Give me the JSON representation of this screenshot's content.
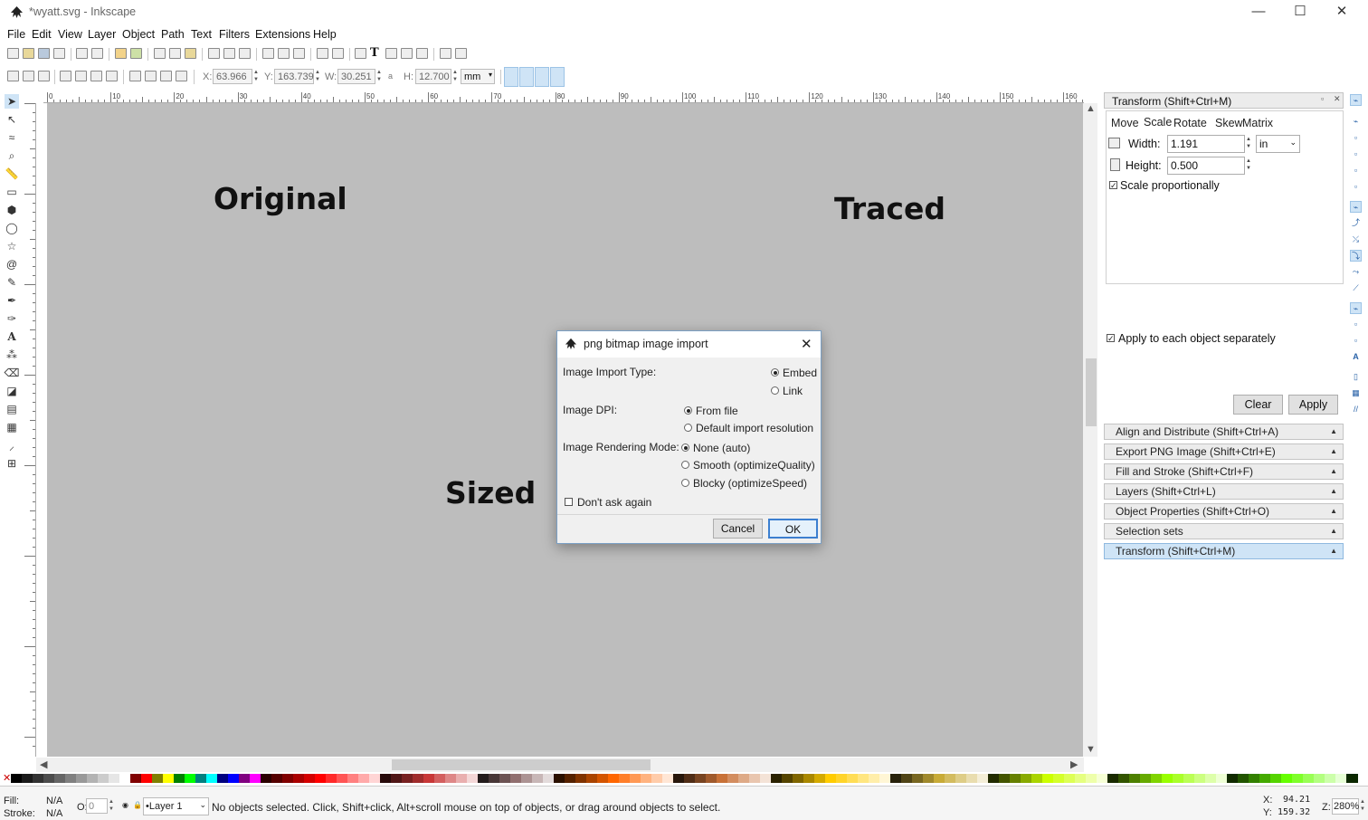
{
  "window": {
    "title": "*wyatt.svg - Inkscape",
    "minimize": "—",
    "maximize": "☐",
    "close": "✕"
  },
  "menubar": [
    "File",
    "Edit",
    "View",
    "Layer",
    "Object",
    "Path",
    "Text",
    "Filters",
    "Extensions",
    "Help"
  ],
  "controls": {
    "x_label": "X:",
    "x_value": "63.966",
    "y_label": "Y:",
    "y_value": "163.739",
    "w_label": "W:",
    "w_value": "30.251",
    "h_label": "H:",
    "h_value": "12.700",
    "unit": "mm"
  },
  "ruler_top": [
    "0",
    "10",
    "20",
    "30",
    "40",
    "50",
    "60",
    "70",
    "80",
    "90",
    "100",
    "110",
    "120",
    "130",
    "140",
    "150",
    "160"
  ],
  "canvas": {
    "texts": [
      "Original",
      "Traced",
      "Sized"
    ],
    "background": "#bdbdbd"
  },
  "dialog": {
    "title": "png bitmap image import",
    "import_type_label": "Image Import Type:",
    "embed": "Embed",
    "link": "Link",
    "dpi_label": "Image DPI:",
    "from_file": "From file",
    "default_res": "Default import resolution",
    "rendering_label": "Image Rendering Mode:",
    "none_auto": "None (auto)",
    "smooth": "Smooth (optimizeQuality)",
    "blocky": "Blocky (optimizeSpeed)",
    "dont_ask": "Don't ask again",
    "cancel": "Cancel",
    "ok": "OK"
  },
  "panel": {
    "header": "Transform (Shift+Ctrl+M)",
    "tabs": [
      "Move",
      "Scale",
      "Rotate",
      "Skew",
      "Matrix"
    ],
    "width_label": "Width:",
    "width_value": "1.191",
    "height_label": "Height:",
    "height_value": "0.500",
    "unit": "in",
    "scale_prop": "Scale proportionally",
    "apply_each": "Apply to each object separately",
    "clear": "Clear",
    "apply": "Apply",
    "docks": [
      "Align and Distribute (Shift+Ctrl+A)",
      "Export PNG Image (Shift+Ctrl+E)",
      "Fill and Stroke (Shift+Ctrl+F)",
      "Layers (Shift+Ctrl+L)",
      "Object Properties (Shift+Ctrl+O)",
      "Selection sets",
      "Transform (Shift+Ctrl+M)"
    ]
  },
  "status": {
    "fill_label": "Fill:",
    "fill_value": "N/A",
    "stroke_label": "Stroke:",
    "stroke_value": "N/A",
    "opacity_label": "O:",
    "opacity_value": "0",
    "layer": "•Layer 1",
    "message": "No objects selected. Click, Shift+click, Alt+scroll mouse on top of objects, or drag around objects to select.",
    "cursor_x_label": "X:",
    "cursor_x": "94.21",
    "cursor_y_label": "Y:",
    "cursor_y": "159.32",
    "zoom_label": "Z:",
    "zoom": "280%"
  },
  "palette": [
    "#000000",
    "#1a1a1a",
    "#333333",
    "#4d4d4d",
    "#666666",
    "#808080",
    "#999999",
    "#b3b3b3",
    "#cccccc",
    "#e6e6e6",
    "#ffffff",
    "#800000",
    "#ff0000",
    "#808000",
    "#ffff00",
    "#008000",
    "#00ff00",
    "#008080",
    "#00ffff",
    "#000080",
    "#0000ff",
    "#800080",
    "#ff00ff",
    "#2b0000",
    "#550000",
    "#800000",
    "#aa0000",
    "#d40000",
    "#ff0000",
    "#ff2a2a",
    "#ff5555",
    "#ff8080",
    "#ffaaaa",
    "#ffd5d5",
    "#280b0b",
    "#501616",
    "#782121",
    "#a02c2c",
    "#c83737",
    "#d35f5f",
    "#de8787",
    "#e9afaf",
    "#f4d7d7",
    "#241c1c",
    "#483737",
    "#6c5353",
    "#916f6f",
    "#ac9393",
    "#c8b7b7",
    "#e3dbdb",
    "#2b1100",
    "#552200",
    "#803300",
    "#aa4400",
    "#d45500",
    "#ff6600",
    "#ff7f2a",
    "#ff9955",
    "#ffb380",
    "#ffccaa",
    "#ffe6d5",
    "#28170b",
    "#502d16",
    "#784421",
    "#a05a2c",
    "#c87137",
    "#d38d5f",
    "#deaa87",
    "#e9c6af",
    "#f4e3d7",
    "#2b2200",
    "#554400",
    "#806600",
    "#aa8800",
    "#d4aa00",
    "#ffcc00",
    "#ffd42a",
    "#ffdd55",
    "#ffe680",
    "#ffeeaa",
    "#fff6d5",
    "#28220b",
    "#504416",
    "#786721",
    "#a0892c",
    "#c8ab37",
    "#d3bc5f",
    "#decd87",
    "#e9ddaf",
    "#f4eed7",
    "#222b00",
    "#445500",
    "#668000",
    "#88aa00",
    "#aad400",
    "#ccff00",
    "#d4ff2a",
    "#ddff55",
    "#e5ff80",
    "#eeffaa",
    "#f6ffd5",
    "#1a2b00",
    "#335500",
    "#4d8000",
    "#66aa00",
    "#80d400",
    "#99ff00",
    "#aaff2a",
    "#bbff55",
    "#ccff80",
    "#ddffaa",
    "#eeffd5",
    "#112b00",
    "#225500",
    "#338000",
    "#44aa00",
    "#55d400",
    "#66ff00",
    "#7fff2a",
    "#99ff55",
    "#b3ff80",
    "#ccffaa",
    "#e6ffd5",
    "#0b2800"
  ]
}
